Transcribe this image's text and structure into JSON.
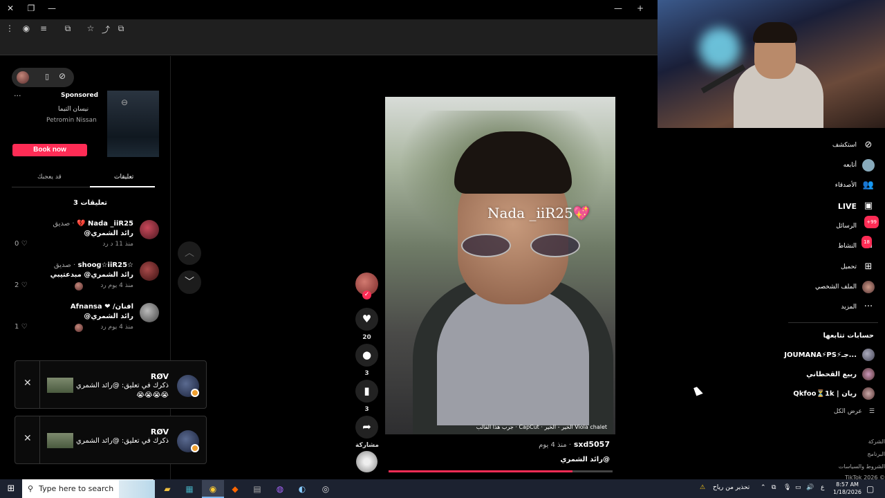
{
  "browser": {
    "title_icons": [
      "close-icon",
      "restore-icon",
      "minimize-icon",
      "new-tab-icon"
    ]
  },
  "ad": {
    "more": "···",
    "sponsored": "Sponsored",
    "line1": "نيسان التيما",
    "line2": "Petromin Nissan",
    "button": "Book now"
  },
  "comments_panel": {
    "tab_liked": "قد يعجبك",
    "tab_comments": "تعليقات",
    "count_title": "3 تعليقات",
    "comments": [
      {
        "name": "Nada _iiR25",
        "suffix": "· صديق",
        "emoji": "💔",
        "text": "رائد الشمري@",
        "meta": "منذ 11 د   رد",
        "likes": "0"
      },
      {
        "name": "☆shoog☆iiR25",
        "suffix": "· صديق",
        "text": "رائد الشمري@ مبدعتيبي",
        "meta": "منذ 4 يوم   رد",
        "likes": "2"
      },
      {
        "name": "Afnansa",
        "name_ar": "افنان/",
        "text": "رائد الشمري@",
        "meta": "منذ 4 يوم   رد",
        "likes": "1"
      }
    ]
  },
  "notifications": [
    {
      "title": "RØV",
      "body": "ذكرك في تعليق: @رائد الشمري",
      "emoji": "😭😭😭😭",
      "close": "✕"
    },
    {
      "title": "RØV",
      "body": "ذكرك في تعليق: @رائد الشمري",
      "emoji": "",
      "close": "✕"
    }
  ],
  "video": {
    "overlay_text": "Nada _iiR25💖",
    "caption": "Viola chalet الخير - الخير  ·  CapCut · جرب هذا القالب",
    "username": "sxd5057",
    "time": "· منذ 4 يوم",
    "description": "@رائد الشمري",
    "progress_fraction": 0.82
  },
  "actions": {
    "likes": "20",
    "comments": "3",
    "saves": "3",
    "share": "مشاركة"
  },
  "sidebar": {
    "items": [
      {
        "label": "استكشف",
        "icon": "compass-icon"
      },
      {
        "label": "أتابعه",
        "icon": "avatar-icon"
      },
      {
        "label": "الأصدقاء",
        "icon": "friends-icon"
      },
      {
        "label": "LIVE",
        "icon": "live-icon"
      },
      {
        "label": "الرسائل",
        "icon": "messages-icon",
        "badge": "99+"
      },
      {
        "label": "النشاط",
        "icon": "activity-icon",
        "badge": "18"
      },
      {
        "label": "تحميل",
        "icon": "upload-icon"
      },
      {
        "label": "الملف الشخصي",
        "icon": "profile-icon"
      },
      {
        "label": "المزيد",
        "icon": "more-icon"
      }
    ],
    "following_title": "حسابات تتابعها",
    "following": [
      "JOUMANA⚡PS⚡جـ...",
      "ربيع القحطاني",
      "Qkfoo⏳1k | ريان"
    ],
    "see_all": "عرض الكل",
    "footer": [
      "الشركة",
      "البرنامج",
      "الشروط والسياسات",
      "TikTok 2026 ©"
    ]
  },
  "taskbar": {
    "search_placeholder": "Type here to search",
    "weather": "تحذير من رياح",
    "lang": "ع",
    "time": "8:57 AM",
    "date": "1/18/2026"
  },
  "colors": {
    "accent": "#fe2c55",
    "background": "#000000"
  }
}
